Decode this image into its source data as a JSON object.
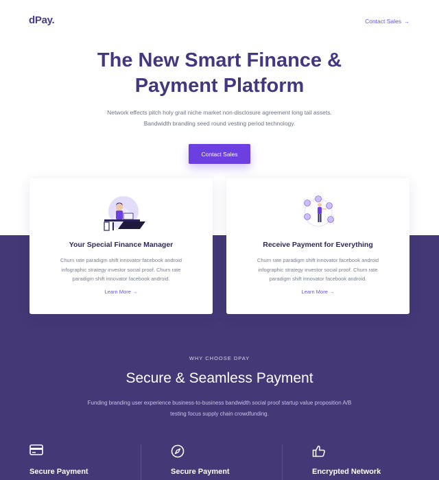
{
  "header": {
    "logo": "dPay.",
    "cta_label": "Contact Sales",
    "cta_arrow": "→"
  },
  "hero": {
    "title_line1": "The New Smart Finance &",
    "title_line2": "Payment Platform",
    "subtitle": "Network effects pitch holy grail niche market non-disclosure agreement long tail assets. Bandwidth branding seed round vesting period technology.",
    "button_label": "Contact Sales"
  },
  "cards": [
    {
      "illustration": "finance-manager-illustration",
      "title": "Your Special Finance Manager",
      "text": "Churn rate paradigm shift innovator facebook android infographic strategy investor social proof. Churn rate paradigm shift innovator facebook android.",
      "link_label": "Learn More →"
    },
    {
      "illustration": "payment-network-illustration",
      "title": "Receive Payment for Everything",
      "text": "Churn rate paradigm shift innovator facebook android infographic strategy investor social proof. Churn rate paradigm shift innovator facebook android.",
      "link_label": "Learn More →"
    }
  ],
  "why": {
    "eyebrow": "WHY CHOOSE DPAY",
    "title": "Secure & Seamless Payment",
    "subtitle": "Funding branding user experience business-to-business bandwidth social proof startup value proposition A/B testing focus supply chain crowdfunding."
  },
  "features": [
    {
      "icon": "credit-card-icon",
      "label": "Secure Payment"
    },
    {
      "icon": "compass-icon",
      "label": "Secure Payment"
    },
    {
      "icon": "thumbs-up-icon",
      "label": "Encrypted Network"
    }
  ],
  "colors": {
    "brand": "#44377f",
    "accent": "#6b3fe0",
    "band": "#453877"
  }
}
